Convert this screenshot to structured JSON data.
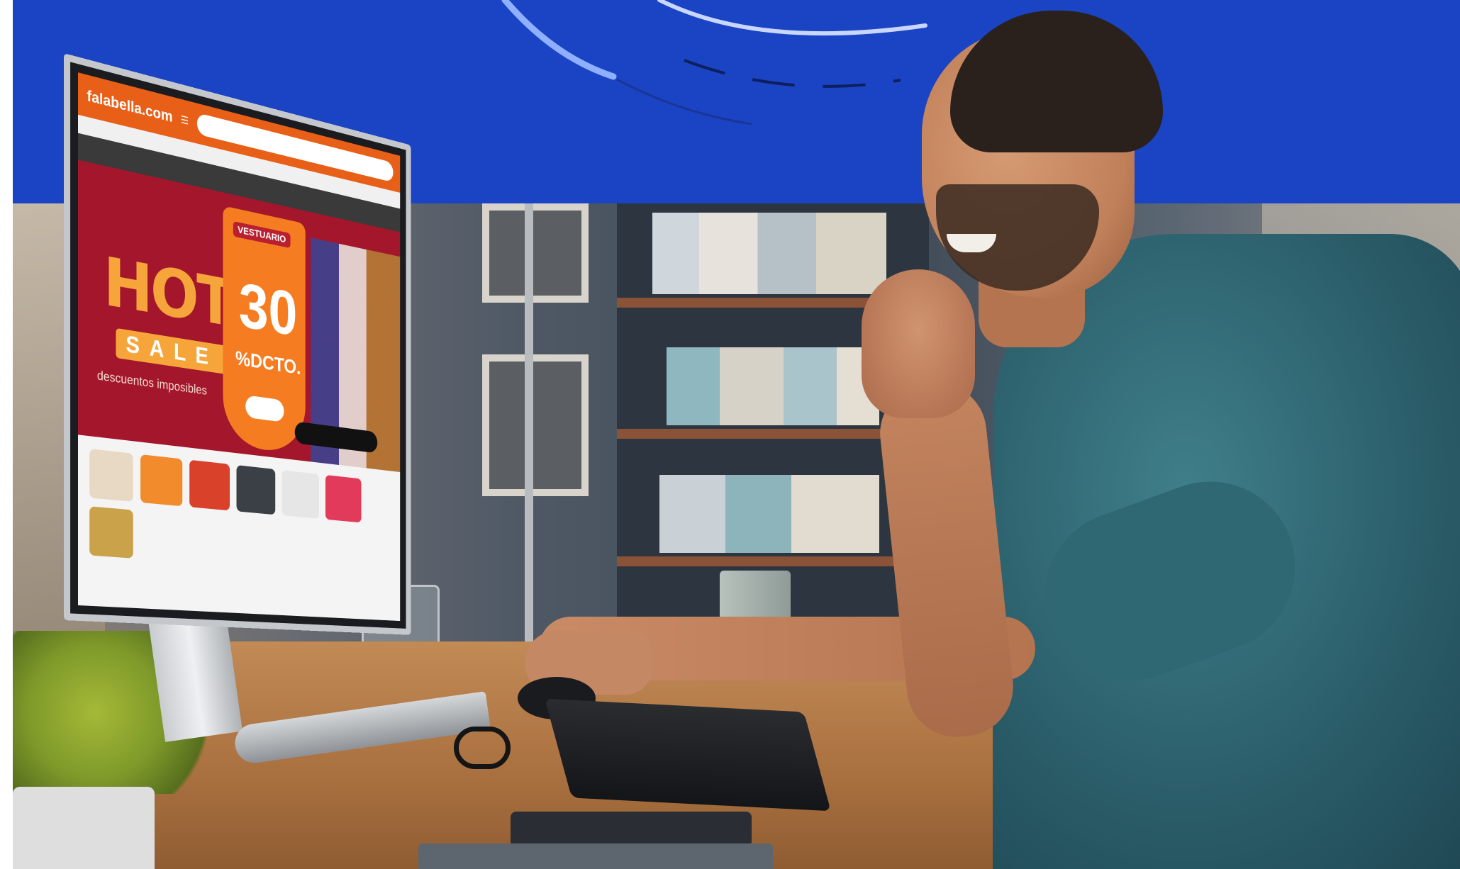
{
  "banner": {
    "brand_color": "#1a44c4"
  },
  "monitor_site": {
    "logo": "falabella.com",
    "hot": "HOT",
    "sale": "SALE",
    "subtitle": "descuentos imposibles",
    "tag": "VESTUARIO",
    "discount_number": "30",
    "discount_text": "%DCTO."
  },
  "colors": {
    "accent_orange": "#e85f18",
    "banner_red": "#a3162b",
    "shirt_teal": "#2b5f6b"
  }
}
